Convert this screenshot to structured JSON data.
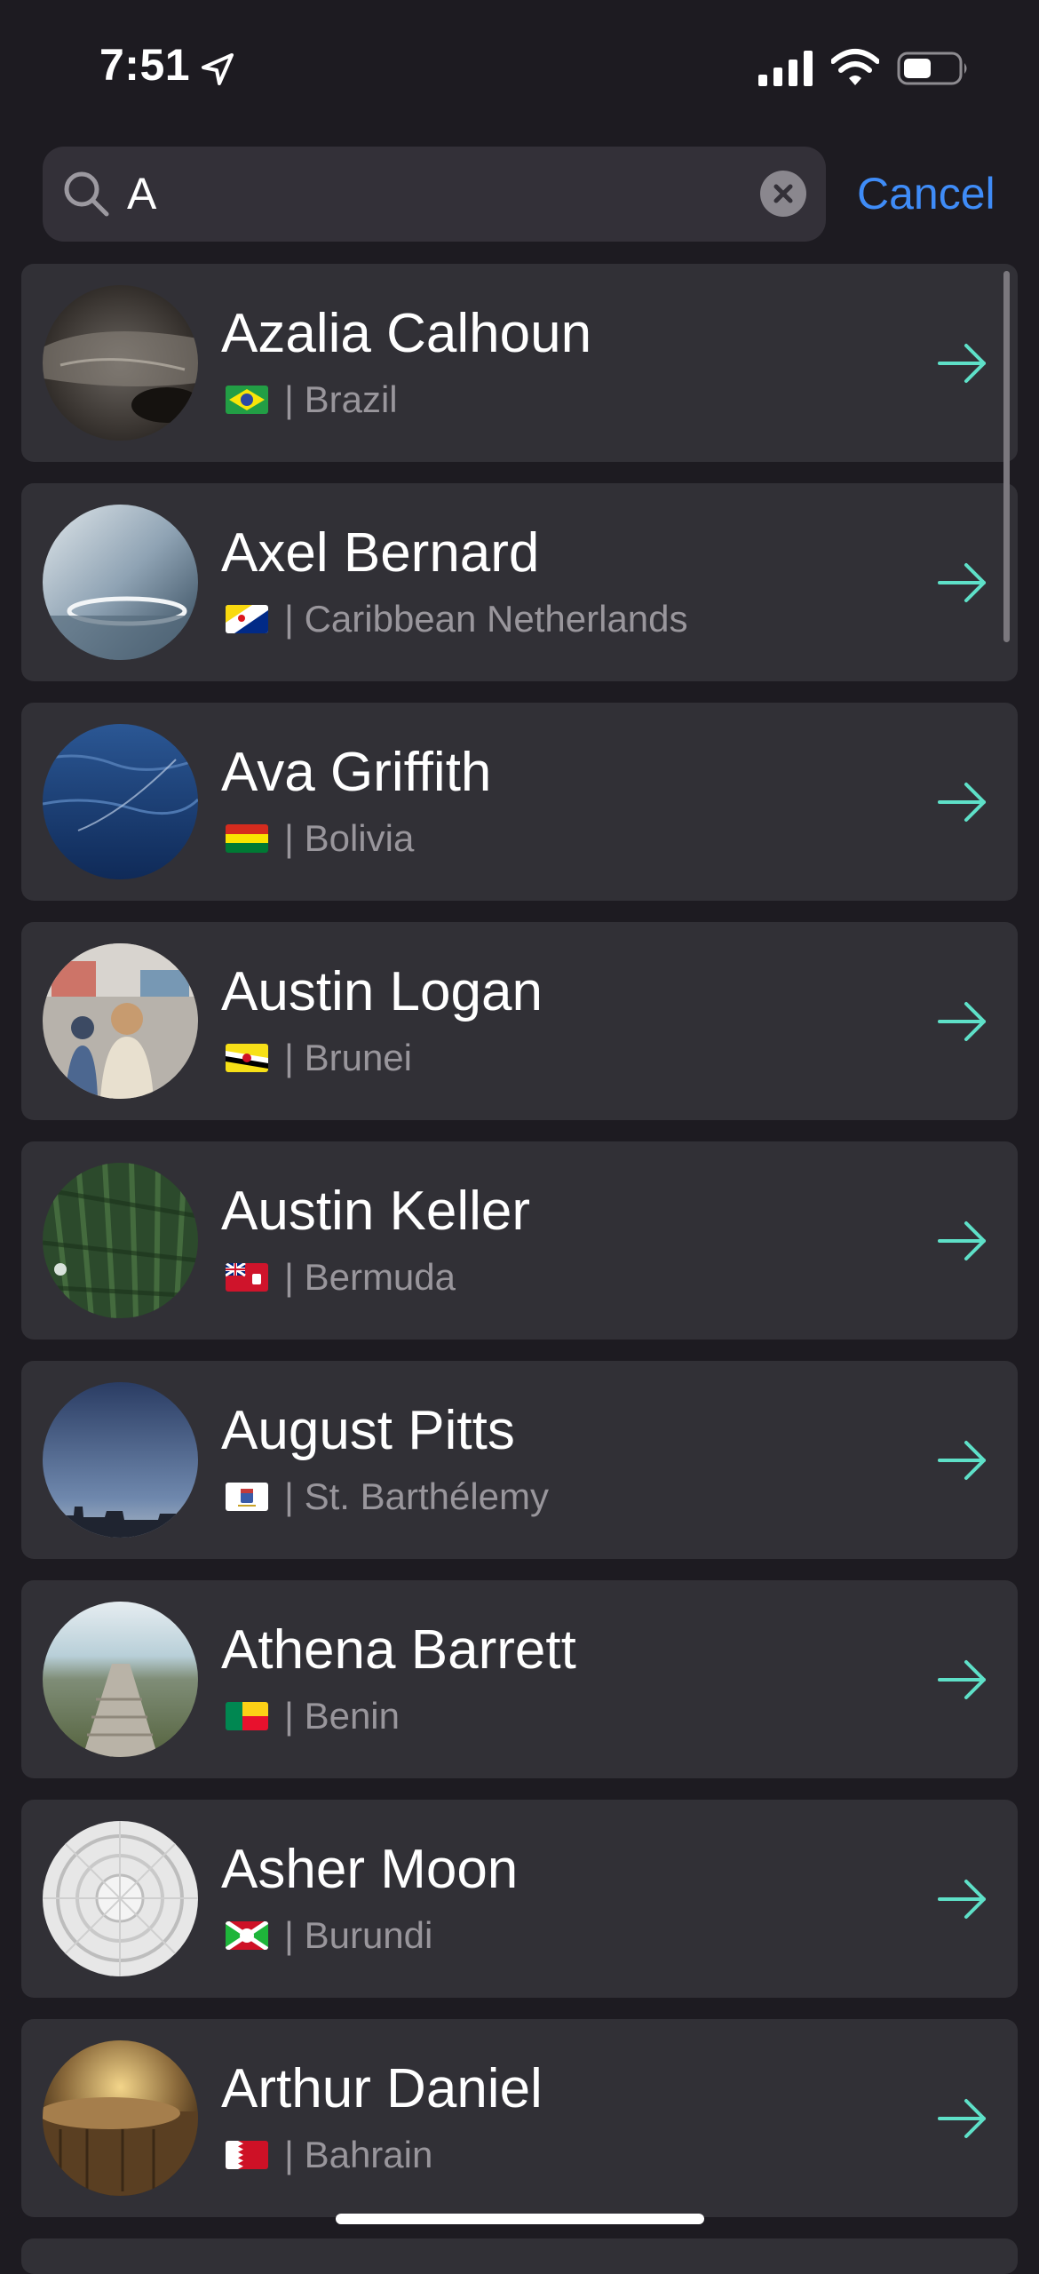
{
  "status_bar": {
    "time": "7:51"
  },
  "search": {
    "query": "A",
    "cancel_label": "Cancel"
  },
  "results": [
    {
      "name": "Azalia Calhoun",
      "country": "| Brazil",
      "flag": "brazil-flag-icon"
    },
    {
      "name": "Axel Bernard",
      "country": "| Caribbean Netherlands",
      "flag": "caribbean-netherlands-flag-icon"
    },
    {
      "name": "Ava Griffith",
      "country": "| Bolivia",
      "flag": "bolivia-flag-icon"
    },
    {
      "name": "Austin Logan",
      "country": "| Brunei",
      "flag": "brunei-flag-icon"
    },
    {
      "name": "Austin Keller",
      "country": "| Bermuda",
      "flag": "bermuda-flag-icon"
    },
    {
      "name": "August Pitts",
      "country": "| St. Barthélemy",
      "flag": "st-barthelemy-flag-icon"
    },
    {
      "name": "Athena Barrett",
      "country": "| Benin",
      "flag": "benin-flag-icon"
    },
    {
      "name": "Asher Moon",
      "country": "| Burundi",
      "flag": "burundi-flag-icon"
    },
    {
      "name": "Arthur Daniel",
      "country": "| Bahrain",
      "flag": "bahrain-flag-icon"
    }
  ],
  "colors": {
    "background": "#1d1b21",
    "card": "#313036",
    "accent": "#3f8cf7",
    "arrow": "#5ee0c8"
  }
}
